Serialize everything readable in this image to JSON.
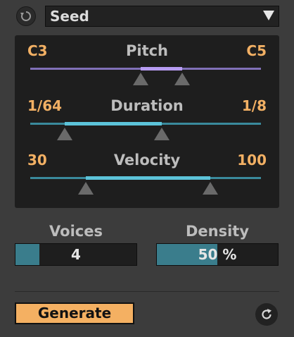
{
  "header": {
    "preset_value": "Seed",
    "icons": {
      "cycle": "cycle-icon",
      "dropdown": "dropdown-arrow-icon"
    }
  },
  "params": [
    {
      "name": "Pitch",
      "low_label": "C3",
      "high_label": "C5",
      "low_fraction": 0.48,
      "high_fraction": 0.66,
      "fill_color": "#b79cf2",
      "track_color": "#8070b8"
    },
    {
      "name": "Duration",
      "low_label": "1/64",
      "high_label": "1/8",
      "low_fraction": 0.15,
      "high_fraction": 0.57,
      "fill_color": "#5cc3d9",
      "track_color": "#3a8a9c"
    },
    {
      "name": "Velocity",
      "low_label": "30",
      "high_label": "100",
      "low_fraction": 0.24,
      "high_fraction": 0.78,
      "fill_color": "#5cc3d9",
      "track_color": "#3a8a9c"
    }
  ],
  "voices": {
    "label": "Voices",
    "value": "4",
    "fill_fraction": 0.2
  },
  "density": {
    "label": "Density",
    "value": "50 %",
    "fill_fraction": 0.5
  },
  "footer": {
    "generate_label": "Generate",
    "icons": {
      "refresh": "refresh-icon"
    }
  },
  "colors": {
    "accent": "#f4b062",
    "value_text": "#f2b064",
    "teal": "#3a7d8c"
  }
}
